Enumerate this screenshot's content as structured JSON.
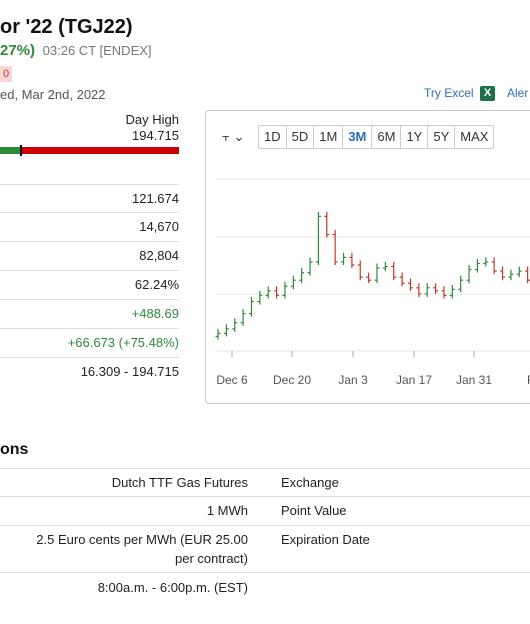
{
  "header": {
    "title": "or '22 (TGJ22)",
    "change_pct": "27%)",
    "time_exchange": "03:26 CT [ENDEX]",
    "badge": "0",
    "updated": "ed, Mar 2nd, 2022",
    "try_excel": "Try Excel",
    "excel_icon_letter": "X",
    "alerts": "Aler"
  },
  "day_range": {
    "day_high_label": "Day High",
    "day_high_value": "194.715",
    "position_pct": 12
  },
  "stats": [
    "121.674",
    "14,670",
    "82,804",
    "62.24%",
    "+488.69",
    "+66.673 (+75.48%)",
    "16.309 - 194.715"
  ],
  "chart": {
    "chart_type_icon": "candlestick-icon",
    "chart_type_glyph": "⫟",
    "caret": "⌄",
    "periods": [
      "1D",
      "5D",
      "1M",
      "3M",
      "6M",
      "1Y",
      "5Y",
      "MAX"
    ],
    "active_period": "3M",
    "x_ticks": [
      "Dec 6",
      "Dec 20",
      "Jan 3",
      "Jan 17",
      "Jan 31",
      "Fe"
    ],
    "up_color": "#2e8b3a",
    "down_color": "#c0392b"
  },
  "chart_data": {
    "type": "line",
    "title": "",
    "xlabel": "",
    "ylabel": "",
    "x_ticks": [
      "Dec 6",
      "Dec 20",
      "Jan 3",
      "Jan 17",
      "Jan 31",
      "Fe"
    ],
    "series": [
      {
        "values": [
          0.05,
          0.08,
          0.12,
          0.18,
          0.26,
          0.3,
          0.33,
          0.3,
          0.36,
          0.4,
          0.45,
          0.52,
          0.82,
          0.7,
          0.52,
          0.55,
          0.5,
          0.42,
          0.4,
          0.48,
          0.49,
          0.42,
          0.38,
          0.35,
          0.31,
          0.35,
          0.33,
          0.3,
          0.34,
          0.4,
          0.47,
          0.51,
          0.52,
          0.46,
          0.42,
          0.44,
          0.46,
          0.4,
          0.39
        ]
      }
    ]
  },
  "specs": {
    "section_title": "ons",
    "rows": [
      {
        "value": "Dutch TTF Gas Futures",
        "label": "Exchange"
      },
      {
        "value": "1 MWh",
        "label": "Point Value"
      },
      {
        "value": "2.5 Euro cents per MWh (EUR 25.00",
        "value2": "per contract)",
        "label": "Expiration Date"
      },
      {
        "value": "8:00a.m. - 6:00p.m. (EST)",
        "label": ""
      }
    ]
  }
}
